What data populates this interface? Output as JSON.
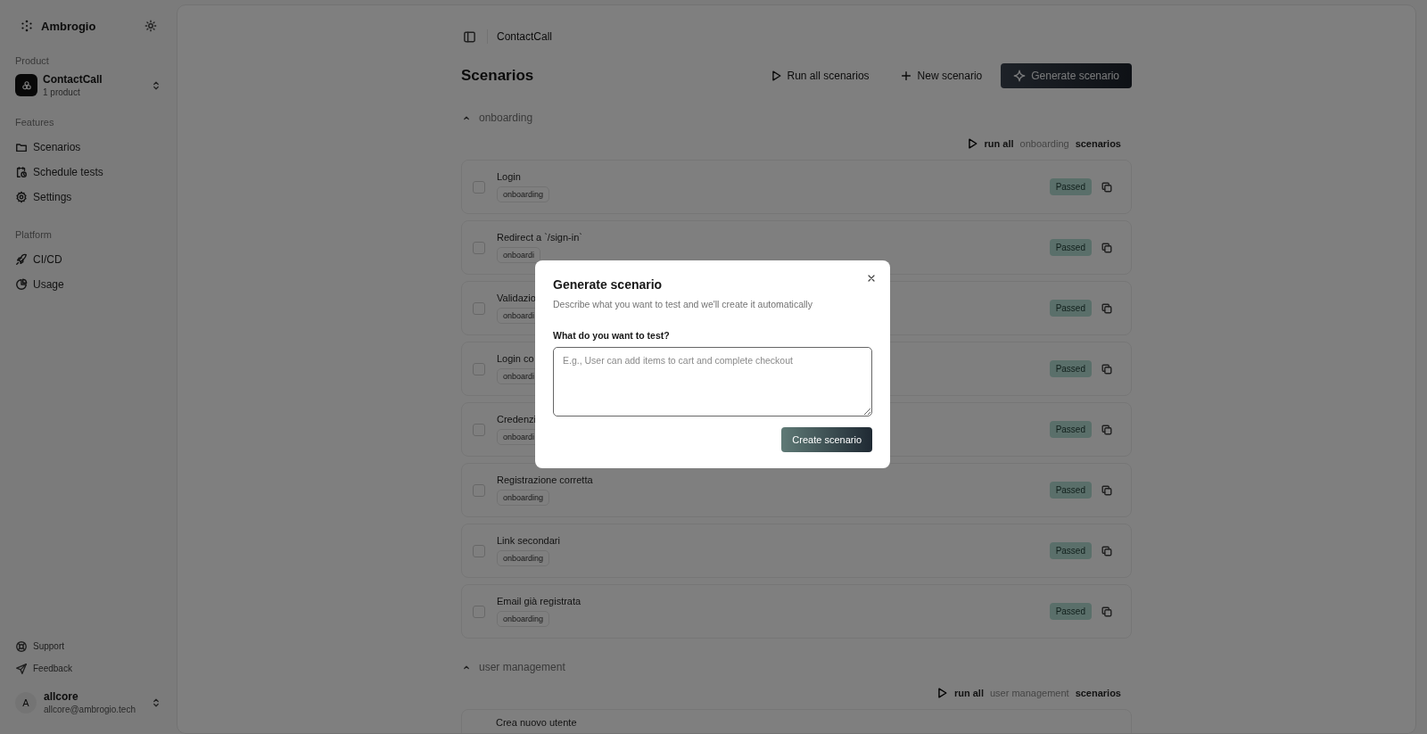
{
  "sidebar": {
    "brand": "Ambrogio",
    "product_label": "Product",
    "product": {
      "name": "ContactCall",
      "count": "1 product"
    },
    "nav_groups": [
      {
        "title": "Features",
        "items": [
          {
            "label": "Scenarios",
            "kind": "folder"
          },
          {
            "label": "Schedule tests",
            "kind": "schedule"
          },
          {
            "label": "Settings",
            "kind": "gear"
          }
        ]
      },
      {
        "title": "Platform",
        "items": [
          {
            "label": "CI/CD",
            "kind": "rocket"
          },
          {
            "label": "Usage",
            "kind": "pie"
          }
        ]
      }
    ],
    "footer_links": [
      {
        "label": "Support",
        "kind": "lifebuoy"
      },
      {
        "label": "Feedback",
        "kind": "send"
      }
    ],
    "user": {
      "avatar": "A",
      "name": "allcore",
      "email": "allcore@ambrogio.tech"
    }
  },
  "breadcrumb": "ContactCall",
  "title": "Scenarios",
  "actions": [
    {
      "label": "Run all scenarios",
      "kind": "play"
    },
    {
      "label": "New scenario",
      "kind": "plus"
    },
    {
      "label": "Generate scenario",
      "kind": "sparkle"
    }
  ],
  "groups": [
    {
      "name": "onboarding",
      "expanded": true,
      "run_all": {
        "prefix": "run all",
        "name": "onboarding",
        "suffix": "scenarios"
      },
      "rows": [
        {
          "name": "Login",
          "tag": "onboarding",
          "status": "Passed",
          "checked": false
        },
        {
          "name": "Redirect a `/sign-in`",
          "tag": "onboardi",
          "status": "Passed",
          "checked": false
        },
        {
          "name": "Validazio",
          "tag": "onboardi",
          "status": "Passed",
          "checked": false
        },
        {
          "name": "Login co",
          "tag": "onboardi",
          "status": "Passed",
          "checked": false
        },
        {
          "name": "Credenzi",
          "tag": "onboardi",
          "status": "Passed",
          "checked": false
        },
        {
          "name": "Registrazione corretta",
          "tag": "onboarding",
          "status": "Passed",
          "checked": false
        },
        {
          "name": "Link secondari",
          "tag": "onboarding",
          "status": "Passed",
          "checked": false
        },
        {
          "name": "Email già registrata",
          "tag": "onboarding",
          "status": "Passed",
          "checked": false
        }
      ]
    },
    {
      "name": "user management",
      "expanded": true,
      "run_all": {
        "prefix": "run all",
        "name": "user management",
        "suffix": "scenarios"
      },
      "rows": [
        {
          "name": "Crea nuovo utente"
        }
      ]
    }
  ],
  "modal": {
    "title": "Generate scenario",
    "description": "Describe what you want to test and we'll create it automatically",
    "field_label": "What do you want to test?",
    "placeholder": "E.g., User can add items to cart and complete checkout",
    "submit": "Create scenario"
  }
}
